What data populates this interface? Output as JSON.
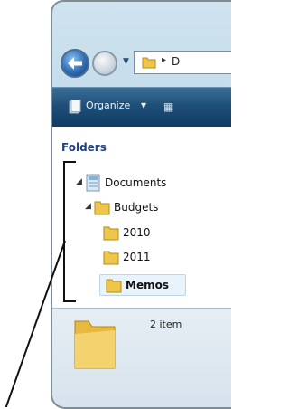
{
  "address": {
    "path_text": "D"
  },
  "toolbar": {
    "organize_label": "Organize",
    "organize_arrow": "▼",
    "views_glyph": "▦"
  },
  "nav_pane": {
    "header": "Folders",
    "items": [
      {
        "label": "Documents",
        "expander": "◢"
      },
      {
        "label": "Budgets",
        "expander": "◢"
      },
      {
        "label": "2010"
      },
      {
        "label": "2011"
      },
      {
        "label": "Memos"
      }
    ]
  },
  "details": {
    "status_text": "2 item"
  },
  "colors": {
    "folder": "#f0c64a",
    "toolbar": "#1f4f78",
    "header_text": "#1e3f8a"
  }
}
